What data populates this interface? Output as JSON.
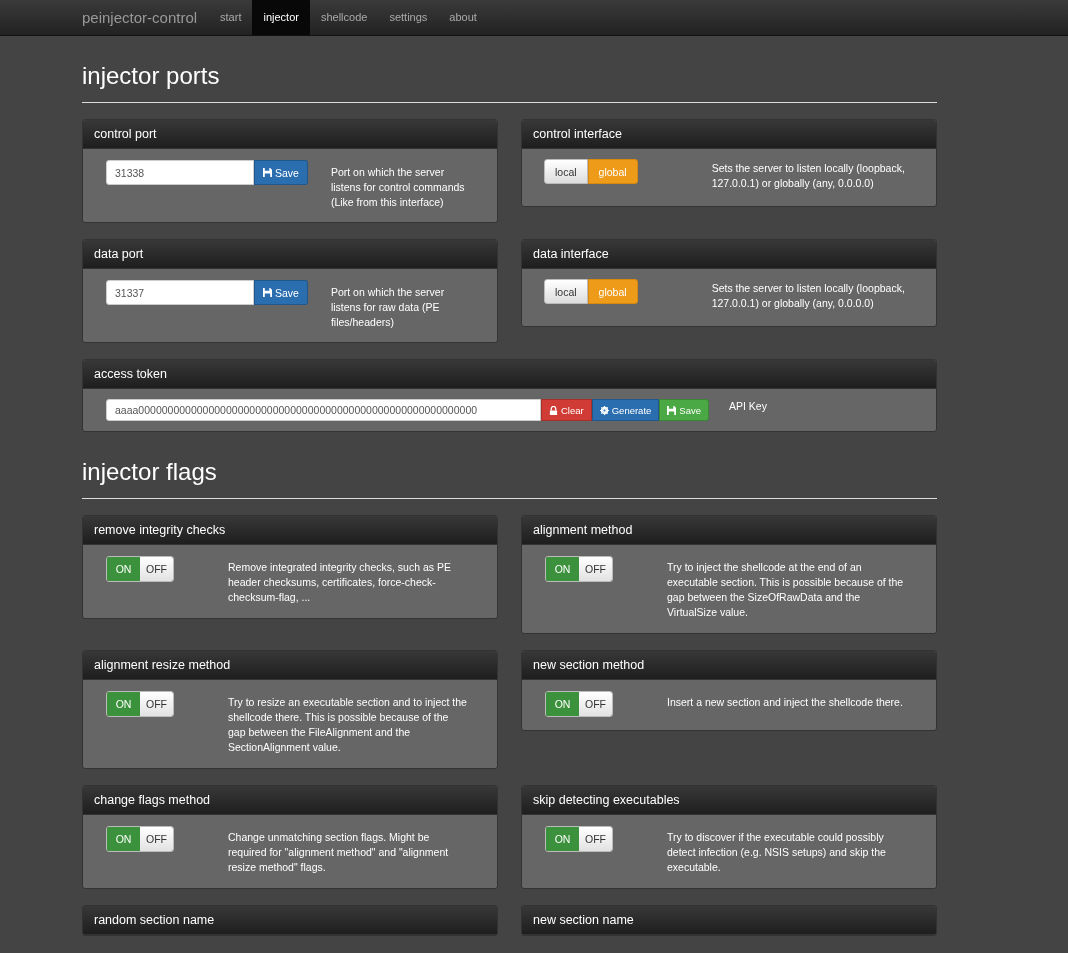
{
  "nav": {
    "brand": "peinjector-control",
    "items": [
      {
        "label": "start",
        "selected": false
      },
      {
        "label": "injector",
        "selected": true
      },
      {
        "label": "shellcode",
        "selected": false
      },
      {
        "label": "settings",
        "selected": false
      },
      {
        "label": "about",
        "selected": false
      }
    ]
  },
  "sections": [
    {
      "title": "injector ports",
      "panels": [
        {
          "kind": "port",
          "title": "control port",
          "value": "31338",
          "button": "Save",
          "description": "Port on which the server listens for control commands (Like from this interface)"
        },
        {
          "kind": "interface",
          "title": "control interface",
          "options": [
            {
              "label": "local",
              "selected": false
            },
            {
              "label": "global",
              "selected": true
            }
          ],
          "description": "Sets the server to listen locally (loopback, 127.0.0.1) or globally (any, 0.0.0.0)"
        },
        {
          "kind": "port",
          "title": "data port",
          "value": "31337",
          "button": "Save",
          "description": "Port on which the server listens for raw data (PE files/headers)"
        },
        {
          "kind": "interface",
          "title": "data interface",
          "options": [
            {
              "label": "local",
              "selected": false
            },
            {
              "label": "global",
              "selected": true
            }
          ],
          "description": "Sets the server to listen locally (loopback, 127.0.0.1) or globally (any, 0.0.0.0)"
        },
        {
          "kind": "token",
          "title": "access token",
          "value": "aaaa0000000000000000000000000000000000000000000000000000000000",
          "buttons": [
            {
              "label": "Clear",
              "kind": "clear"
            },
            {
              "label": "Generate",
              "kind": "generate"
            },
            {
              "label": "Save",
              "kind": "save"
            }
          ],
          "note": "API Key"
        }
      ]
    },
    {
      "title": "injector flags",
      "panels": [
        {
          "kind": "switch",
          "title": "remove integrity checks",
          "on": true,
          "on_label": "ON",
          "off_label": "OFF",
          "description": "Remove integrated integrity checks, such as PE header checksums, certificates, force-check-checksum-flag, ..."
        },
        {
          "kind": "switch",
          "title": "alignment method",
          "on": true,
          "on_label": "ON",
          "off_label": "OFF",
          "description": "Try to inject the shellcode at the end of an executable section. This is possible because of the gap between the SizeOfRawData and the VirtualSize value."
        },
        {
          "kind": "switch",
          "title": "alignment resize method",
          "on": true,
          "on_label": "ON",
          "off_label": "OFF",
          "description": "Try to resize an executable section and to inject the shellcode there. This is possible because of the gap between the FileAlignment and the SectionAlignment value."
        },
        {
          "kind": "switch",
          "title": "new section method",
          "on": true,
          "on_label": "ON",
          "off_label": "OFF",
          "description": "Insert a new section and inject the shellcode there."
        },
        {
          "kind": "switch",
          "title": "change flags method",
          "on": true,
          "on_label": "ON",
          "off_label": "OFF",
          "description": "Change unmatching section flags. Might be required for \"alignment method\" and \"alignment resize method\" flags."
        },
        {
          "kind": "switch",
          "title": "skip detecting executables",
          "on": true,
          "on_label": "ON",
          "off_label": "OFF",
          "description": "Try to discover if the executable could possibly detect infection (e.g. NSIS setups) and skip the executable."
        },
        {
          "kind": "cut",
          "title": "random section name"
        },
        {
          "kind": "cut",
          "title": "new section name"
        }
      ]
    }
  ]
}
